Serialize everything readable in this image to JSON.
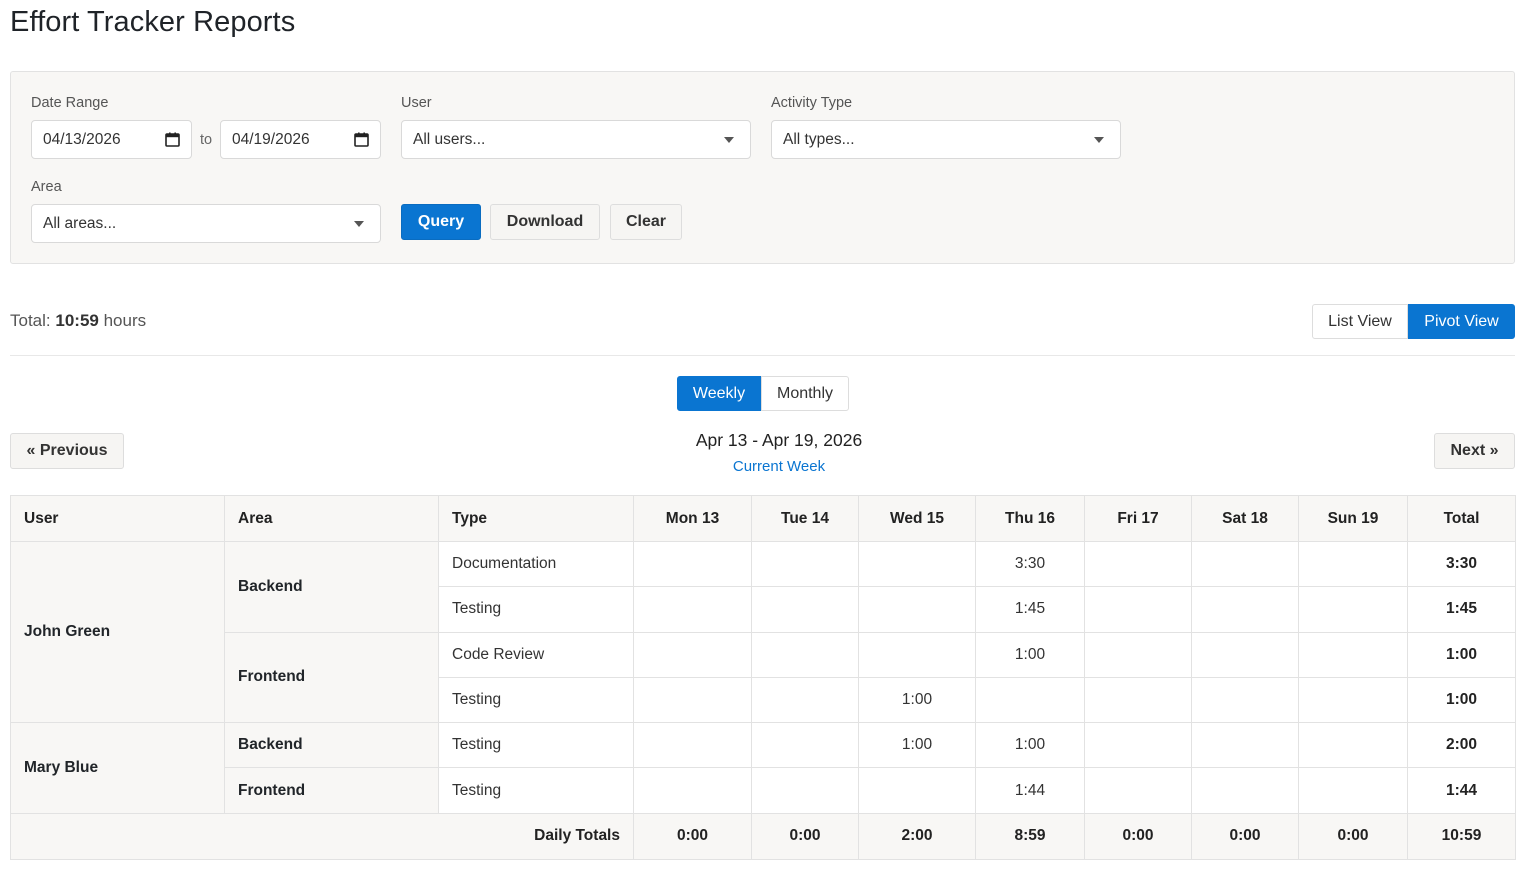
{
  "page": {
    "title": "Effort Tracker Reports"
  },
  "filters": {
    "date_range_label": "Date Range",
    "date_from": "04/13/2026",
    "to_label": "to",
    "date_to": "04/19/2026",
    "user_label": "User",
    "user_value": "All users...",
    "activity_label": "Activity Type",
    "activity_value": "All types...",
    "area_label": "Area",
    "area_value": "All areas...",
    "query_label": "Query",
    "download_label": "Download",
    "clear_label": "Clear"
  },
  "summary": {
    "total_prefix": "Total:",
    "total_value": "10:59",
    "total_suffix": "hours"
  },
  "views": {
    "list_label": "List View",
    "pivot_label": "Pivot View",
    "active": "pivot"
  },
  "period": {
    "weekly_label": "Weekly",
    "monthly_label": "Monthly",
    "active": "weekly"
  },
  "navigation": {
    "previous_label": "« Previous",
    "next_label": "Next »",
    "range_title": "Apr 13 - Apr 19, 2026",
    "current_week_label": "Current Week"
  },
  "table": {
    "headers": {
      "user": "User",
      "area": "Area",
      "type": "Type",
      "days": [
        "Mon 13",
        "Tue 14",
        "Wed 15",
        "Thu 16",
        "Fri 17",
        "Sat 18",
        "Sun 19"
      ],
      "total": "Total"
    },
    "rows": [
      {
        "user": "John Green",
        "area": "Backend",
        "type": "Documentation",
        "days": [
          "",
          "",
          "",
          "3:30",
          "",
          "",
          ""
        ],
        "total": "3:30"
      },
      {
        "user": "John Green",
        "area": "Backend",
        "type": "Testing",
        "days": [
          "",
          "",
          "",
          "1:45",
          "",
          "",
          ""
        ],
        "total": "1:45"
      },
      {
        "user": "John Green",
        "area": "Frontend",
        "type": "Code Review",
        "days": [
          "",
          "",
          "",
          "1:00",
          "",
          "",
          ""
        ],
        "total": "1:00"
      },
      {
        "user": "John Green",
        "area": "Frontend",
        "type": "Testing",
        "days": [
          "",
          "",
          "1:00",
          "",
          "",
          "",
          ""
        ],
        "total": "1:00"
      },
      {
        "user": "Mary Blue",
        "area": "Backend",
        "type": "Testing",
        "days": [
          "",
          "",
          "1:00",
          "1:00",
          "",
          "",
          ""
        ],
        "total": "2:00"
      },
      {
        "user": "Mary Blue",
        "area": "Frontend",
        "type": "Testing",
        "days": [
          "",
          "",
          "",
          "1:44",
          "",
          "",
          ""
        ],
        "total": "1:44"
      }
    ],
    "footer": {
      "label": "Daily Totals",
      "days": [
        "0:00",
        "0:00",
        "2:00",
        "8:59",
        "0:00",
        "0:00",
        "0:00"
      ],
      "total": "10:59"
    }
  },
  "colors": {
    "accent": "#0a75d1",
    "panel_bg": "#f8f7f5",
    "border": "#e2e2e2"
  },
  "icons": {
    "date_picker": "calendar-icon",
    "select": "chevron-down-icon"
  }
}
